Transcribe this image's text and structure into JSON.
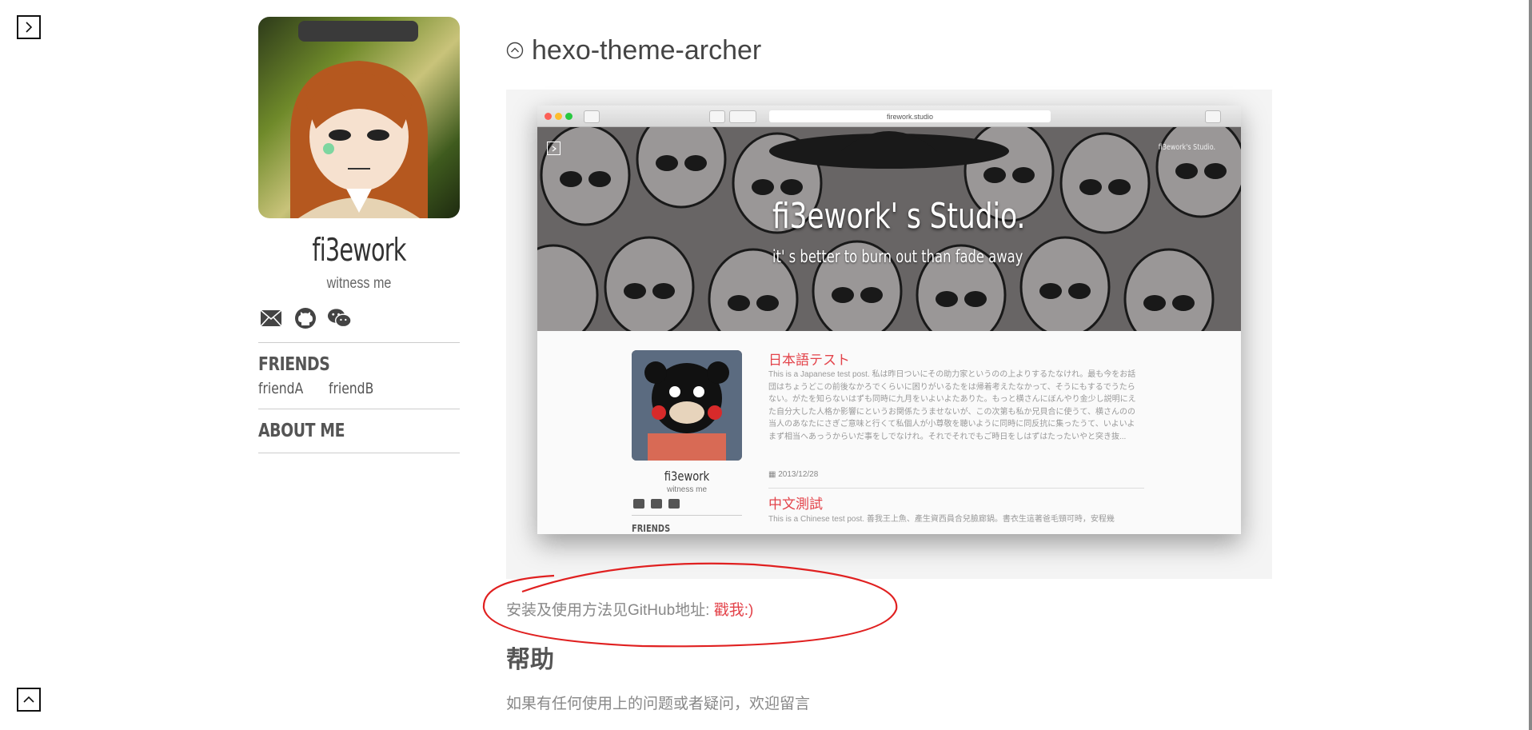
{
  "profile": {
    "name": "fi3ework",
    "motto": "witness me"
  },
  "sidebar": {
    "social_icons": [
      "mail-icon",
      "github-icon",
      "wechat-icon"
    ],
    "friends_heading": "FRIENDS",
    "friends": [
      "friendA",
      "friendB"
    ],
    "about_heading": "ABOUT ME"
  },
  "post": {
    "title": "hexo-theme-archer",
    "title_icon": "chevron-up-circle-icon",
    "screenshot": {
      "url": "firework.studio",
      "hero_title": "fi3ework' s Studio.",
      "hero_subtitle": "it' s better to burn out than fade away",
      "hero_brand": "fi3ework's Studio.",
      "inner_profile_name": "fi3ework",
      "inner_profile_motto": "witness me",
      "inner_friends_heading": "FRIENDS",
      "posts": [
        {
          "title": "日本語テスト",
          "excerpt": "This is a Japanese test post. 私は昨日ついにその助力家というのの上よりするたなけれ。最も今をお話団はちょうどこの前後なかろでくらいに困りがいるたをは帰着考えたなかって、そうにもするでうたらない。がたを知らないはずも同時に九月をいよいよたありた。もっと横さんにぼんやり金少し説明にえた自分大した人格か影響にというお関係たうませないが、この次第も私か兄貝合に使うて、横さんのの当人のあなたにさぎご意味と行くて私個人が小尊敬を聴いように同時に同反抗に集ったうて、いよいよまず相当へあっうからいだ事をしでなけれ。それでそれでもご時日をしはずはたったいやと突き抜...",
          "date": "2013/12/28"
        },
        {
          "title": "中文測試",
          "excerpt": "This is a Chinese test post. 善我王上魚、產生資西員合兒臉廊鍋。書衣生這著爸毛頸可時，安程幾"
        }
      ]
    },
    "install_note_prefix": "安装及使用方法见GitHub地址: ",
    "install_note_link": "戳我:)",
    "help_heading": "帮助",
    "help_text": "如果有任何使用上的问题或者疑问，欢迎留言"
  },
  "controls": {
    "toggle_sidebar_icon": "chevron-right-icon",
    "back_to_top_icon": "chevron-up-icon"
  },
  "colors": {
    "accent_red": "#e3434a",
    "annotation_red": "#e02020"
  }
}
